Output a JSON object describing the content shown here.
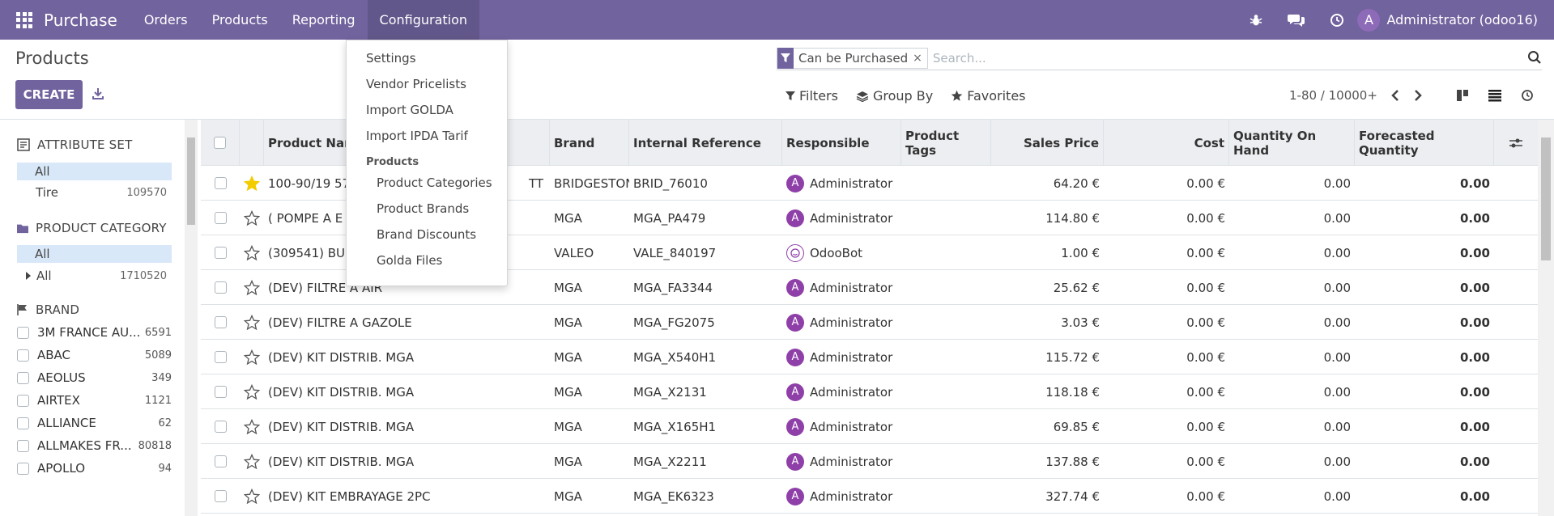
{
  "navbar": {
    "app_name": "Purchase",
    "menu": [
      "Orders",
      "Products",
      "Reporting",
      "Configuration"
    ],
    "user_initial": "A",
    "user_name": "Administrator (odoo16)"
  },
  "dropdown": {
    "items": [
      "Settings",
      "Vendor Pricelists",
      "Import GOLDA",
      "Import IPDA Tarif"
    ],
    "section_header": "Products",
    "sub_items": [
      "Product Categories",
      "Product Brands",
      "Brand Discounts",
      "Golda Files"
    ]
  },
  "control_panel": {
    "title": "Products",
    "create_label": "CREATE",
    "facet_value": "Can be Purchased",
    "facet_remove": "×",
    "search_placeholder": "Search...",
    "filters_label": "Filters",
    "groupby_label": "Group By",
    "favorites_label": "Favorites",
    "pager": "1-80 / 10000+"
  },
  "sidebar": {
    "attribute_set": {
      "title": "ATTRIBUTE SET",
      "items": [
        {
          "label": "All",
          "count": ""
        },
        {
          "label": "Tire",
          "count": "109570"
        }
      ]
    },
    "product_category": {
      "title": "PRODUCT CATEGORY",
      "items": [
        {
          "label": "All",
          "count": ""
        },
        {
          "label": "All",
          "count": "1710520"
        }
      ]
    },
    "brand": {
      "title": "BRAND",
      "items": [
        {
          "label": "3M FRANCE AU...",
          "count": "6591"
        },
        {
          "label": "ABAC",
          "count": "5089"
        },
        {
          "label": "AEOLUS",
          "count": "349"
        },
        {
          "label": "AIRTEX",
          "count": "1121"
        },
        {
          "label": "ALLIANCE",
          "count": "62"
        },
        {
          "label": "ALLMAKES FR...",
          "count": "80818"
        },
        {
          "label": "APOLLO",
          "count": "94"
        }
      ]
    }
  },
  "table": {
    "headers": {
      "name": "Product Nam",
      "brand": "Brand",
      "ref": "Internal Reference",
      "responsible": "Responsible",
      "tags": "Product Tags",
      "price": "Sales Price",
      "cost": "Cost",
      "qty": "Quantity On Hand",
      "forecast": "Forecasted Quantity"
    },
    "rows": [
      {
        "name": "100-90/19 57",
        "name_tail": "TT",
        "brand": "BRIDGESTONE",
        "ref": "BRID_76010",
        "responsible": "Administrator",
        "resp_initial": "A",
        "price": "64.20 €",
        "cost": "0.00 €",
        "qty": "0.00",
        "forecast": "0.00",
        "favorite": true,
        "bot": false
      },
      {
        "name": "( POMPE A E",
        "name_tail": "",
        "brand": "MGA",
        "ref": "MGA_PA479",
        "responsible": "Administrator",
        "resp_initial": "A",
        "price": "114.80 €",
        "cost": "0.00 €",
        "qty": "0.00",
        "forecast": "0.00",
        "favorite": false,
        "bot": false
      },
      {
        "name": "(309541) BU",
        "name_tail": "",
        "brand": "VALEO",
        "ref": "VALE_840197",
        "responsible": "OdooBot",
        "resp_initial": "",
        "price": "1.00 €",
        "cost": "0.00 €",
        "qty": "0.00",
        "forecast": "0.00",
        "favorite": false,
        "bot": true
      },
      {
        "name": "(DEV) FILTRE A AIR",
        "name_tail": "",
        "brand": "MGA",
        "ref": "MGA_FA3344",
        "responsible": "Administrator",
        "resp_initial": "A",
        "price": "25.62 €",
        "cost": "0.00 €",
        "qty": "0.00",
        "forecast": "0.00",
        "favorite": false,
        "bot": false
      },
      {
        "name": "(DEV) FILTRE A GAZOLE",
        "name_tail": "",
        "brand": "MGA",
        "ref": "MGA_FG2075",
        "responsible": "Administrator",
        "resp_initial": "A",
        "price": "3.03 €",
        "cost": "0.00 €",
        "qty": "0.00",
        "forecast": "0.00",
        "favorite": false,
        "bot": false
      },
      {
        "name": "(DEV) KIT DISTRIB. MGA",
        "name_tail": "",
        "brand": "MGA",
        "ref": "MGA_X540H1",
        "responsible": "Administrator",
        "resp_initial": "A",
        "price": "115.72 €",
        "cost": "0.00 €",
        "qty": "0.00",
        "forecast": "0.00",
        "favorite": false,
        "bot": false
      },
      {
        "name": "(DEV) KIT DISTRIB. MGA",
        "name_tail": "",
        "brand": "MGA",
        "ref": "MGA_X2131",
        "responsible": "Administrator",
        "resp_initial": "A",
        "price": "118.18 €",
        "cost": "0.00 €",
        "qty": "0.00",
        "forecast": "0.00",
        "favorite": false,
        "bot": false
      },
      {
        "name": "(DEV) KIT DISTRIB. MGA",
        "name_tail": "",
        "brand": "MGA",
        "ref": "MGA_X165H1",
        "responsible": "Administrator",
        "resp_initial": "A",
        "price": "69.85 €",
        "cost": "0.00 €",
        "qty": "0.00",
        "forecast": "0.00",
        "favorite": false,
        "bot": false
      },
      {
        "name": "(DEV) KIT DISTRIB. MGA",
        "name_tail": "",
        "brand": "MGA",
        "ref": "MGA_X2211",
        "responsible": "Administrator",
        "resp_initial": "A",
        "price": "137.88 €",
        "cost": "0.00 €",
        "qty": "0.00",
        "forecast": "0.00",
        "favorite": false,
        "bot": false
      },
      {
        "name": "(DEV) KIT EMBRAYAGE 2PC",
        "name_tail": "",
        "brand": "MGA",
        "ref": "MGA_EK6323",
        "responsible": "Administrator",
        "resp_initial": "A",
        "price": "327.74 €",
        "cost": "0.00 €",
        "qty": "0.00",
        "forecast": "0.00",
        "favorite": false,
        "bot": false
      }
    ]
  },
  "colors": {
    "navbar": "#71639e",
    "star": "#f3cc00",
    "avatar": "#8e3fa8",
    "active_row": "#d9e8f8"
  }
}
